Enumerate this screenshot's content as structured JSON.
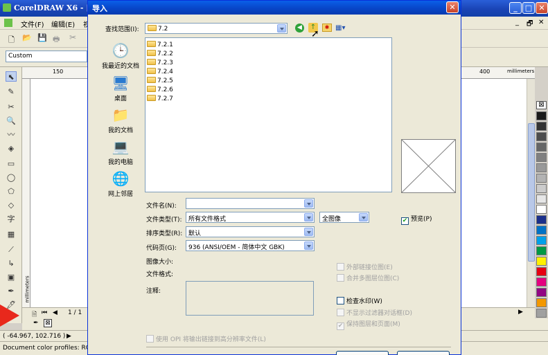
{
  "app": {
    "title": "CorelDRAW X6 - [",
    "menu": [
      "文件(F)",
      "编辑(E)",
      "视"
    ],
    "preset": "Custom",
    "ruler_ticks_top": [
      "150",
      "400"
    ],
    "ruler_unit": "millimeters",
    "ruler_left_label": "millimeters",
    "page_nav": "1 / 1",
    "cursor_position": "( -64.967, 102.716 )",
    "status_text": "Document color profiles: RGB: s"
  },
  "palette_colors": [
    "#ffffff",
    "#000000",
    "#1a1a1a",
    "#333333",
    "#4d4d4d",
    "#666666",
    "#808080",
    "#999999",
    "#b3b3b3",
    "#cccccc",
    "#e6e6e6",
    "#ffffff",
    "#1b2f8a",
    "#0072c6",
    "#00a0e9",
    "#009944",
    "#fff100",
    "#e60012",
    "#e4007f",
    "#920783",
    "#f39800",
    "#a0a0a0"
  ],
  "dialog": {
    "title": "导入",
    "look_in_label": "查找范围(I):",
    "look_in_value": "7.2",
    "places": [
      "我最近的文档",
      "桌面",
      "我的文档",
      "我的电脑",
      "网上邻居"
    ],
    "files": [
      "7.2.1",
      "7.2.2",
      "7.2.3",
      "7.2.4",
      "7.2.5",
      "7.2.6",
      "7.2.7"
    ],
    "filename_label": "文件名(N):",
    "filename_value": "",
    "filetype_label": "文件类型(T):",
    "filetype_value": "所有文件格式",
    "image_mode_value": "全图像",
    "preview_label": "预览(P)",
    "sort_label": "排序类型(R):",
    "sort_value": "默认",
    "codepage_label": "代码页(G):",
    "codepage_value": "936  (ANSI/OEM - 简体中文 GBK)",
    "image_size_label": "图像大小:",
    "file_format_label": "文件格式:",
    "notes_label": "注释:",
    "opt_external_link": "外部链接位图(E)",
    "opt_combine_layers": "合并多图层位图(C)",
    "opt_watermark": "检查水印(W)",
    "opt_no_filter_dialog": "不显示过滤器对话框(D)",
    "opt_keep_layers": "保持图层和页面(M)",
    "opt_opi": "使用 OPI 将输出链接到高分辨率文件(L)"
  },
  "icons": [
    "search-icon",
    "back-icon",
    "up-folder-icon",
    "new-folder-icon",
    "view-menu-icon",
    "folder-icon",
    "recent-docs-icon",
    "desktop-icon",
    "my-documents-icon",
    "my-computer-icon",
    "network-icon",
    "close-icon"
  ]
}
